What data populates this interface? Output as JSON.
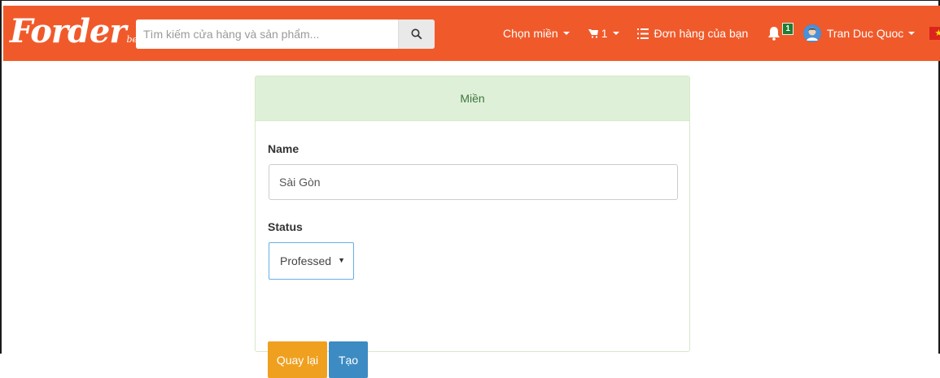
{
  "navbar": {
    "logo": "Forder",
    "logo_sub": "beta",
    "search_placeholder": "Tìm kiếm cửa hàng và sản phẩm...",
    "region_menu": "Chọn miền",
    "cart_count": "1",
    "orders_label": "Đơn hàng của bạn",
    "notification_count": "1",
    "user_name": "Tran Duc Quoc",
    "bg_color": "#f05a2b"
  },
  "panel": {
    "title": "Miền",
    "name_label": "Name",
    "name_value": "Sài Gòn",
    "status_label": "Status",
    "status_value": "Professed",
    "back_button": "Quay lại",
    "create_button": "Tạo",
    "heading_color": "#dff0d8",
    "back_color": "#f0a01f",
    "create_color": "#3d8bc3"
  }
}
